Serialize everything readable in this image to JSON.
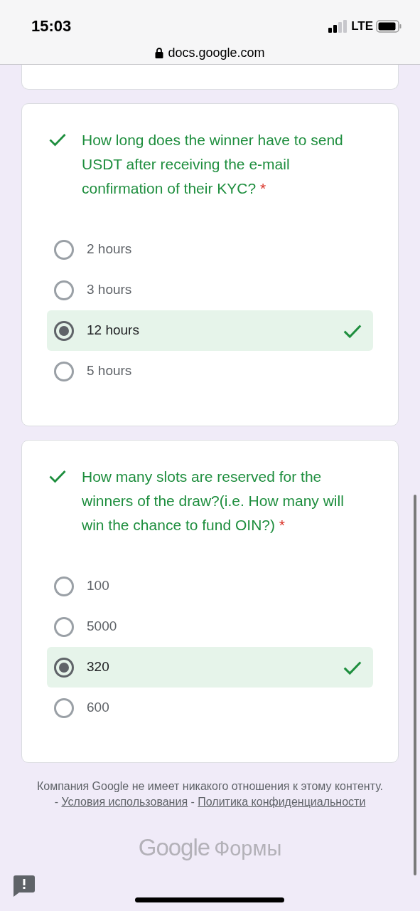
{
  "status_bar": {
    "time": "15:03",
    "network": "LTE"
  },
  "address_bar": {
    "url": "docs.google.com"
  },
  "questions": [
    {
      "text": "How long does the winner have to send USDT after receiving the e-mail confirmation of their KYC?",
      "required_mark": "*",
      "correct": true,
      "options": [
        {
          "label": "2 hours",
          "selected": false,
          "correct": false
        },
        {
          "label": "3 hours",
          "selected": false,
          "correct": false
        },
        {
          "label": "12 hours",
          "selected": true,
          "correct": true
        },
        {
          "label": "5 hours",
          "selected": false,
          "correct": false
        }
      ]
    },
    {
      "text": "How many slots are reserved for the winners of the draw?(i.e. How many will win the chance to fund OIN?)",
      "required_mark": "*",
      "correct": true,
      "options": [
        {
          "label": "100",
          "selected": false,
          "correct": false
        },
        {
          "label": "5000",
          "selected": false,
          "correct": false
        },
        {
          "label": "320",
          "selected": true,
          "correct": true
        },
        {
          "label": "600",
          "selected": false,
          "correct": false
        }
      ]
    }
  ],
  "footer": {
    "parts": [
      {
        "kind": "text",
        "text": "Компания Google не имеет никакого отношения к этому контенту. -"
      },
      {
        "kind": "link",
        "text": "Условия использования"
      },
      {
        "kind": "text",
        "text": "-"
      },
      {
        "kind": "link",
        "text": "Политика конфиденциальности"
      }
    ]
  },
  "logo": {
    "brand": "Google",
    "product": "Формы"
  }
}
